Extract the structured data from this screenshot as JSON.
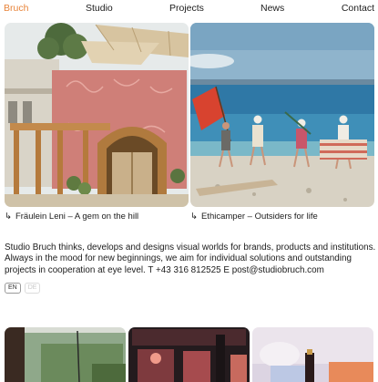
{
  "nav": {
    "brand": "Bruch",
    "studio": "Studio",
    "projects": "Projects",
    "news": "News",
    "contact": "Contact",
    "brand_color": "#e8843a"
  },
  "projects": [
    {
      "title": "Fräulein Leni – A gem on the hill",
      "arrow": "↳"
    },
    {
      "title": "Ethicamper – Outsiders for life",
      "arrow": "↳"
    }
  ],
  "intro": "Studio Bruch thinks, develops and designs visual worlds for brands, products and institutions. Always in the mood for new beginnings, we aim for individual solutions and outstanding projects in cooperation at eye level. T +43 316 812525 E post@studiobruch.com",
  "language": {
    "active": "EN",
    "inactive": "DE"
  }
}
